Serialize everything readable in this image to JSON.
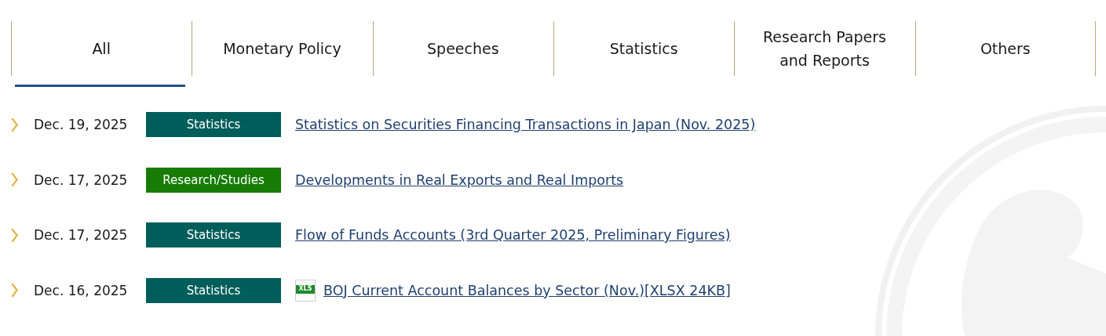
{
  "tabs": [
    {
      "label": "All",
      "selected": true
    },
    {
      "label": "Monetary Policy",
      "selected": false
    },
    {
      "label": "Speeches",
      "selected": false
    },
    {
      "label": "Statistics",
      "selected": false
    },
    {
      "label": "Research Papers and Reports",
      "selected": false
    },
    {
      "label": "Others",
      "selected": false
    }
  ],
  "news": [
    {
      "date": "Dec. 19, 2025",
      "category": "Statistics",
      "color": "#005e5a",
      "title": "Statistics on Securities Financing Transactions in Japan (Nov. 2025)"
    },
    {
      "date": "Dec. 17, 2025",
      "category": "Research/Studies",
      "color": "#167c05",
      "title": "Developments in Real Exports and Real Imports"
    },
    {
      "date": "Dec. 17, 2025",
      "category": "Statistics",
      "color": "#005e5a",
      "title": "Flow of Funds Accounts (3rd Quarter 2025, Preliminary Figures)"
    },
    {
      "date": "Dec. 16, 2025",
      "category": "Statistics",
      "color": "#005e5a",
      "file_type": "XLS",
      "title": "BOJ Current Account Balances by Sector (Nov.)[XLSX 24KB]"
    }
  ]
}
